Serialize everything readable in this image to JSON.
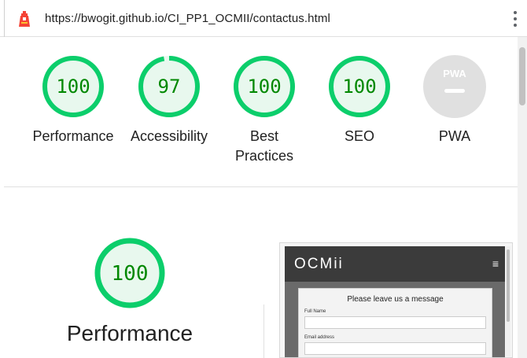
{
  "urlbar": {
    "url": "https://bwogit.github.io/CI_PP1_OCMII/contactus.html",
    "logo_icon": "lighthouse-icon",
    "menu_icon": "kebab-menu-icon"
  },
  "colors": {
    "pass": "#0cce6b",
    "pass_fill": "#e8f8ee",
    "pass_text": "#008800",
    "pwa_gray": "#e0e0e0",
    "logo": "#f44336"
  },
  "categories": [
    {
      "label": "Performance",
      "score": "100",
      "fraction": 1.0
    },
    {
      "label": "Accessibility",
      "score": "97",
      "fraction": 0.97
    },
    {
      "label": "Best\nPractices",
      "label_line1": "Best",
      "label_line2": "Practices",
      "score": "100",
      "fraction": 1.0
    },
    {
      "label": "SEO",
      "score": "100",
      "fraction": 1.0
    },
    {
      "label": "PWA",
      "badge_text": "PWA"
    }
  ],
  "performance_section": {
    "score": "100",
    "fraction": 1.0,
    "title": "Performance"
  },
  "screenshot": {
    "brand": "OCMii",
    "menu_glyph": "≡",
    "card_title": "Please leave us a message",
    "field1_label": "Full Name",
    "field2_label": "Email address"
  }
}
